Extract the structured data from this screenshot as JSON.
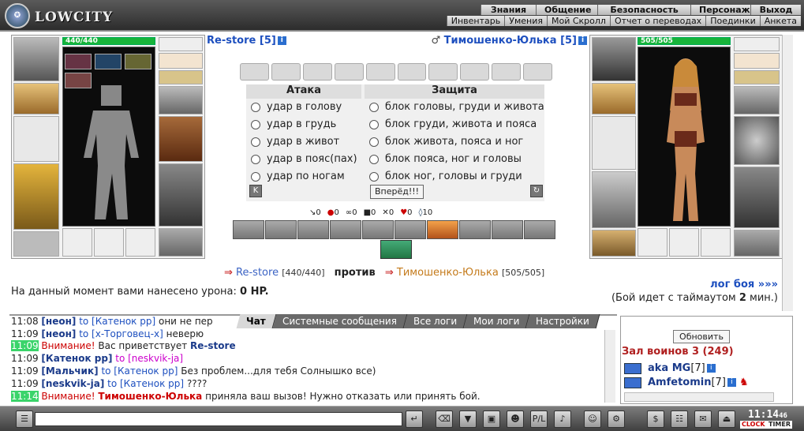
{
  "header": {
    "logo": "LOWCITY",
    "menu_top": [
      "Знания",
      "Общение",
      "Безопасность",
      "Персонаж",
      "Выход"
    ],
    "menu_bottom": [
      "Инвентарь",
      "Умения",
      "Мой Скролл",
      "Отчет о переводах",
      "Поединки",
      "Анкета"
    ]
  },
  "left_char": {
    "name": "Re-store",
    "level": "[5]",
    "hp": "440/440",
    "hp_fraction": 1.0
  },
  "right_char": {
    "name": "Тимошенко-Юлька",
    "level": "[5]",
    "hp": "505/505",
    "hp_fraction": 1.0
  },
  "combat": {
    "attack_title": "Атака",
    "defense_title": "Защита",
    "attacks": [
      "удар в голову",
      "удар в грудь",
      "удар в живот",
      "удар в пояс(пах)",
      "удар по ногам"
    ],
    "defenses": [
      "блок головы, груди и живота",
      "блок груди, живота и пояса",
      "блок живота, пояса и ног",
      "блок пояса, ног и головы",
      "блок ног, головы и груди"
    ],
    "go_button": "Вперёд!!!",
    "stats": [
      "0",
      "0",
      "0",
      "0",
      "0",
      "0",
      "10"
    ]
  },
  "vs": {
    "player1": "Re-store",
    "player1_hp": "[440/440]",
    "against": "против",
    "player2": "Тимошенко-Юлька",
    "player2_hp": "[505/505]"
  },
  "damage": {
    "prefix": "На данный момент вами нанесено урона:",
    "value": "0 HP."
  },
  "battle_log": {
    "link": "лог боя »»»",
    "timeout_prefix": "(Бой идет с таймаутом",
    "timeout_value": "2",
    "timeout_suffix": "мин.)"
  },
  "chat": {
    "tabs": [
      "Чат",
      "Системные сообщения",
      "Все логи",
      "Мои логи",
      "Настройки"
    ],
    "lines": [
      {
        "time": "11:08",
        "nick": "[неон]",
        "to": "to [Катенок pp]",
        "text": "они не пер"
      },
      {
        "time": "11:09",
        "nick": "[неон]",
        "to": "to [х-Торговец-х]",
        "text": "неверю"
      },
      {
        "time": "11:09",
        "warn": "Внимание!",
        "text": "Вас приветствует",
        "bold": "Re-store"
      },
      {
        "time": "11:09",
        "nick": "[Катенок pp]",
        "to": "to [neskvik-ja]",
        "text": ""
      },
      {
        "time": "11:09",
        "nick": "[Мальчик]",
        "to": "to [Катенок pp]",
        "text": "Без проблем...для тебя Солнышко все)"
      },
      {
        "time": "11:09",
        "nick": "[neskvik-ja]",
        "to": "to [Катенок pp]",
        "text": "????"
      },
      {
        "time": "11:14",
        "warn": "Внимание!",
        "bold": "Тимошенко-Юлька",
        "text": "приняла ваш вызов! Нужно отказать или принять бой."
      }
    ]
  },
  "warriors": {
    "refresh": "Обновить",
    "hall": "Зал воинов 3 (249)",
    "list": [
      {
        "name": "aka MG",
        "level": "[7]"
      },
      {
        "name": "Amfetomin",
        "level": "[7]"
      }
    ]
  },
  "clock": {
    "time": "11:14",
    "seconds": "46",
    "clock_label": "CLOCK",
    "timer_label": "TIMER"
  },
  "colors": {
    "hp_green": "#17b43a",
    "link_blue": "#1d4fbf",
    "alert_red": "#c00000",
    "chat_time_green": "#3ad46a"
  }
}
